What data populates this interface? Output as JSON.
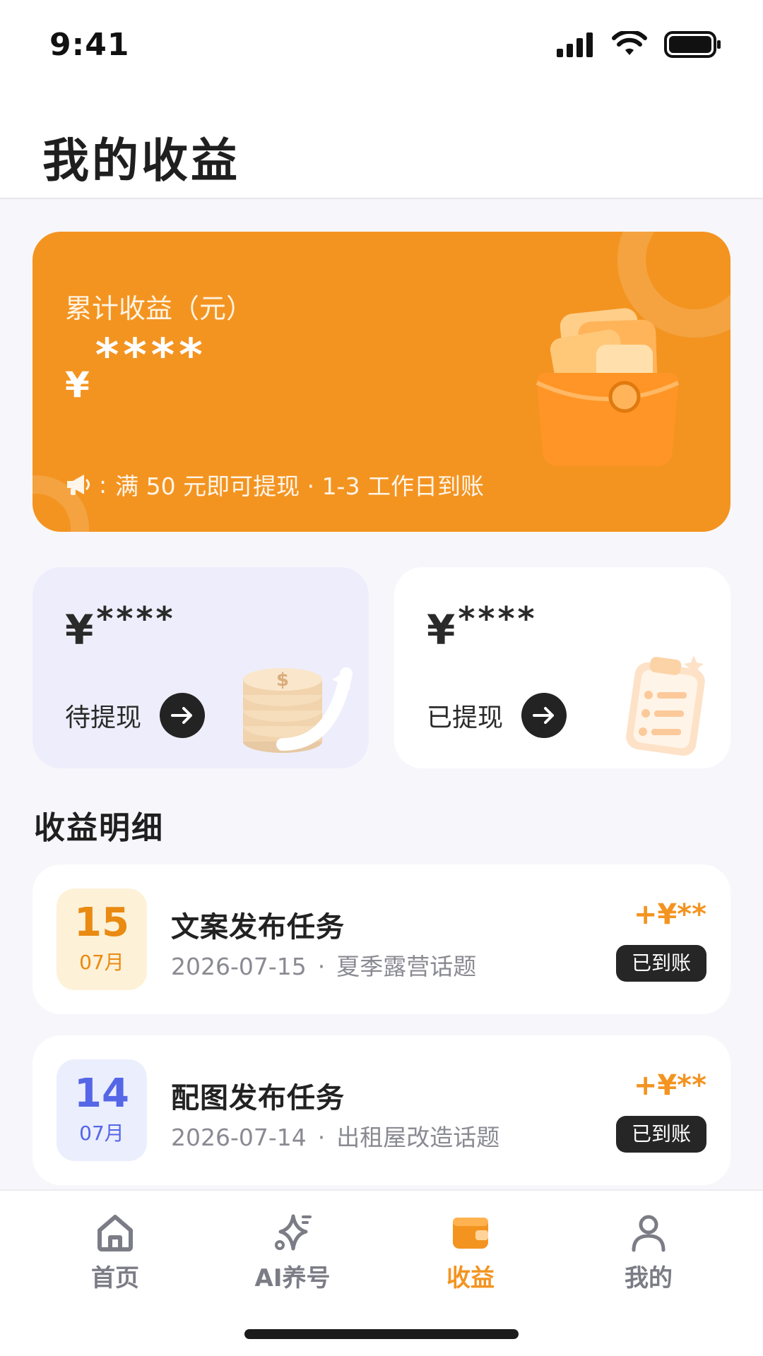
{
  "status_bar": {
    "time": "9:41"
  },
  "header": {
    "title": "我的收益"
  },
  "hero": {
    "label": "累计收益（元）",
    "currency": "¥",
    "amount_masked": "****",
    "notice": "满 50 元即可提现 · 1-3 工作日到账",
    "notice_prefix": ":"
  },
  "stats": [
    {
      "amount": "¥",
      "amount_masked": "****",
      "label": "待提现"
    },
    {
      "amount": "¥",
      "amount_masked": "****",
      "label": "已提现"
    }
  ],
  "section": {
    "title": "收益明细"
  },
  "records": [
    {
      "day": "15",
      "month": "07月",
      "title": "文案发布任务",
      "date": "2026-07-15",
      "topic": "夏季露营话题",
      "amount": "+¥**",
      "status": "已到账"
    },
    {
      "day": "14",
      "month": "07月",
      "title": "配图发布任务",
      "date": "2026-07-14",
      "topic": "出租屋改造话题",
      "amount": "+¥**",
      "status": "已到账"
    }
  ],
  "separator": "·",
  "nav": [
    {
      "label": "首页",
      "icon": "home-icon"
    },
    {
      "label": "AI养号",
      "icon": "sparkle-icon"
    },
    {
      "label": "收益",
      "icon": "wallet-icon"
    },
    {
      "label": "我的",
      "icon": "user-icon"
    }
  ],
  "colors": {
    "accent": "#f39421",
    "dark": "#262626",
    "purple": "#5566e6"
  }
}
